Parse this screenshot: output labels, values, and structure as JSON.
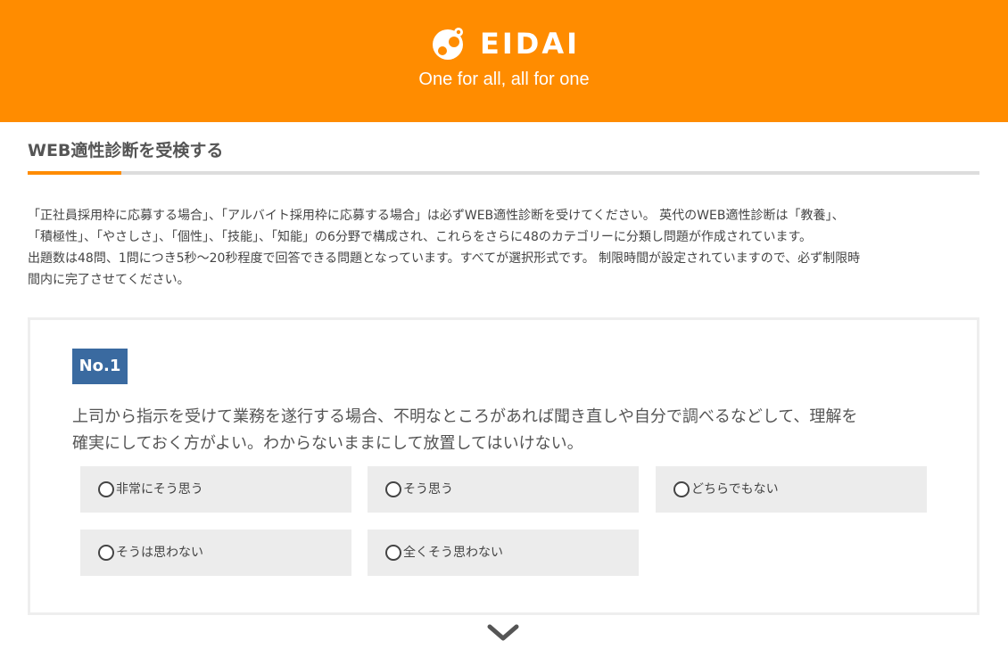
{
  "header": {
    "brand_name": "EIDAI",
    "tagline": "One for all, all for one",
    "colors": {
      "background": "#ff8c00",
      "text": "#ffffff"
    },
    "logo_icon": "eidai-logo-icon"
  },
  "section": {
    "title": "WEB適性診断を受検する",
    "accent_color": "#ff8c00"
  },
  "intro": {
    "lines": [
      "「正社員採用枠に応募する場合」、「アルバイト採用枠に応募する場合」は必ずWEB適性診断を受けてください。 英代のWEB適性診断は「教養」、",
      "「積極性」、「やさしさ」、「個性」、「技能」、「知能」の6分野で構成され、これらをさらに48のカテゴリーに分類し問題が作成されています。",
      "出題数は48問、1問につき5秒～20秒程度で回答できる問題となっています。すべてが選択形式です。 制限時間が設定されていますので、必ず制限時",
      "間内に完了させてください。"
    ]
  },
  "question": {
    "number": "No.1",
    "number_color": "#3a6aa0",
    "text_lines": [
      "上司から指示を受けて業務を遂行する場合、不明なところがあれば聞き直しや自分で調べるなどして、理解を",
      "確実にしておく方がよい。わからないままにして放置してはいけない。"
    ],
    "options": [
      "非常にそう思う",
      "そう思う",
      "どちらでもない",
      "そうは思わない",
      "全くそう思わない"
    ]
  },
  "navigation": {
    "next_icon": "chevron-down-icon"
  }
}
